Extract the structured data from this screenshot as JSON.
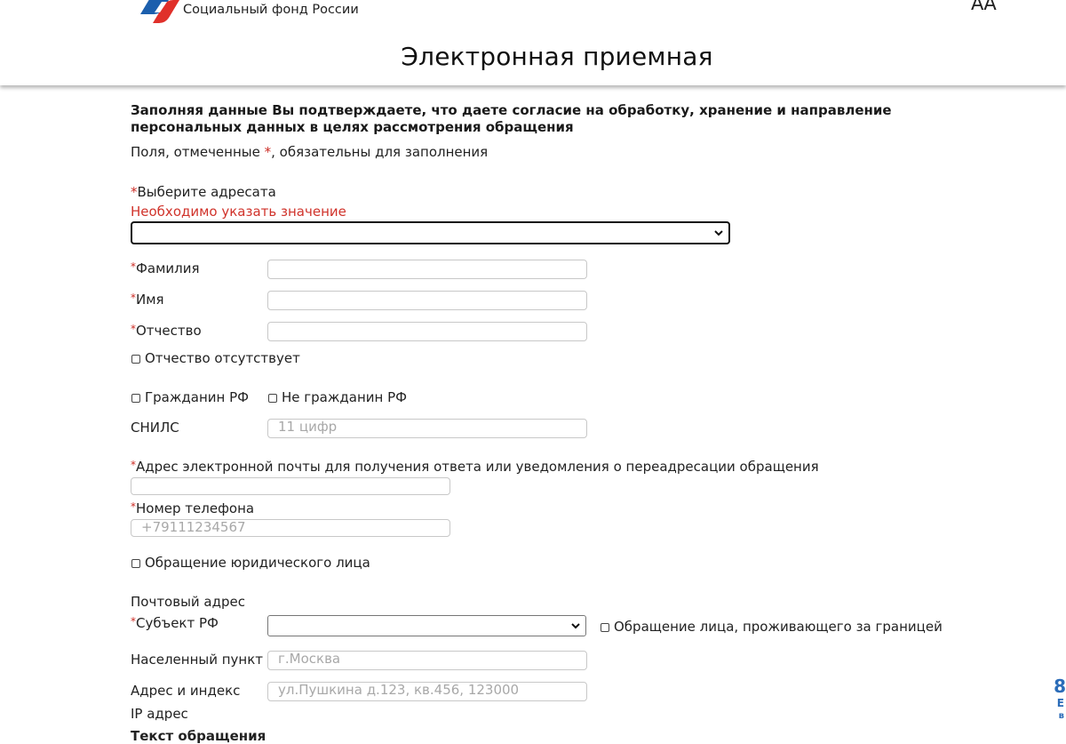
{
  "header": {
    "org_name": "Социальный фонд России",
    "font_toggle": "АА",
    "title": "Электронная приемная"
  },
  "form": {
    "consent_text": "Заполняя данные Вы подтверждаете, что даете согласие на обработку, хранение и направление персональных данных в целях рассмотрения обращения",
    "required_note_prefix": "Поля, отмеченные",
    "required_star": "*",
    "required_note_suffix": ", обязательны для заполнения",
    "addressee_label": "Выберите адресата",
    "addressee_error": "Необходимо указать значение",
    "addressee_value": "",
    "surname_label": "Фамилия",
    "name_label": "Имя",
    "patronymic_label": "Отчество",
    "no_patronymic_label": "Отчество отсутствует",
    "citizen_rf_label": "Гражданин РФ",
    "not_citizen_rf_label": "Не гражданин РФ",
    "snils_label": "СНИЛС",
    "snils_placeholder": "11 цифр",
    "email_label": "Адрес электронной почты для получения ответа или уведомления о переадресации обращения",
    "phone_label": "Номер телефона",
    "phone_placeholder": "+79111234567",
    "legal_entity_label": "Обращение юридического лица",
    "postal_address_label": "Почтовый адрес",
    "region_label": "Субъект РФ",
    "region_value": "",
    "abroad_label": "Обращение лица, проживающего за границей",
    "locality_label": "Населенный пункт",
    "locality_placeholder": "г.Москва",
    "address_label": "Адрес и индекс",
    "address_placeholder": "ул.Пушкина д.123, кв.456, 123000",
    "ip_label": "IP адрес",
    "text_label": "Текст обращения"
  },
  "side": {
    "digit": "8",
    "line1": "Е",
    "line2": "в"
  },
  "colors": {
    "required": "#cc2b24",
    "logo_blue": "#1c5fad",
    "logo_red": "#e0302a"
  }
}
